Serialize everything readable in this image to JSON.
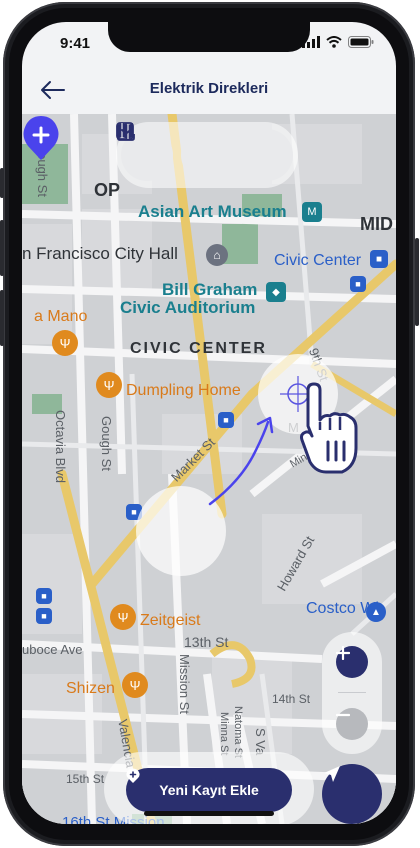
{
  "status": {
    "time": "9:41"
  },
  "header": {
    "title": "Elektrik Direkleri"
  },
  "toolbar": {
    "buttons": [
      "checklist-icon",
      "map-icon",
      "download-icon"
    ]
  },
  "map_labels": {
    "op": "OP",
    "asian_art": "Asian Art Museum",
    "mid": "MID",
    "sf_city_hall": "n Francisco City Hall",
    "civic_center_bart": "Civic Center",
    "bill_graham_1": "Bill Graham",
    "bill_graham_2": "Civic Auditorium",
    "a_mano": "a Mano",
    "civic_center_district": "CIVIC CENTER",
    "dumpling_home": "Dumpling Home",
    "zeitgeist": "Zeitgeist",
    "costco": "Costco Wh",
    "shizen": "Shizen",
    "mission_16th": "16th St Mission",
    "gough_st_top": "Gough St",
    "gough_st": "Gough St",
    "octavia": "Octavia Blvd",
    "market_st": "Market St",
    "ninth_st": "9th St",
    "minna_st": "Minna St",
    "howard_st": "Howard St",
    "duboce": "uboce Ave",
    "thirteenth_st": "13th St",
    "mission_st": "Mission St",
    "natoma": "Natoma St",
    "minna_st_2": "Minna St",
    "valencia": "Valencia",
    "s_van": "S Va",
    "fourteenth_st": "14th St",
    "fifteenth_st": "15th St",
    "m_label": "M"
  },
  "actions": {
    "add_record": "Yeni Kayıt Ekle"
  },
  "colors": {
    "primary": "#2a2f6e",
    "pin": "#4a43ec",
    "title": "#1d2a5c"
  }
}
